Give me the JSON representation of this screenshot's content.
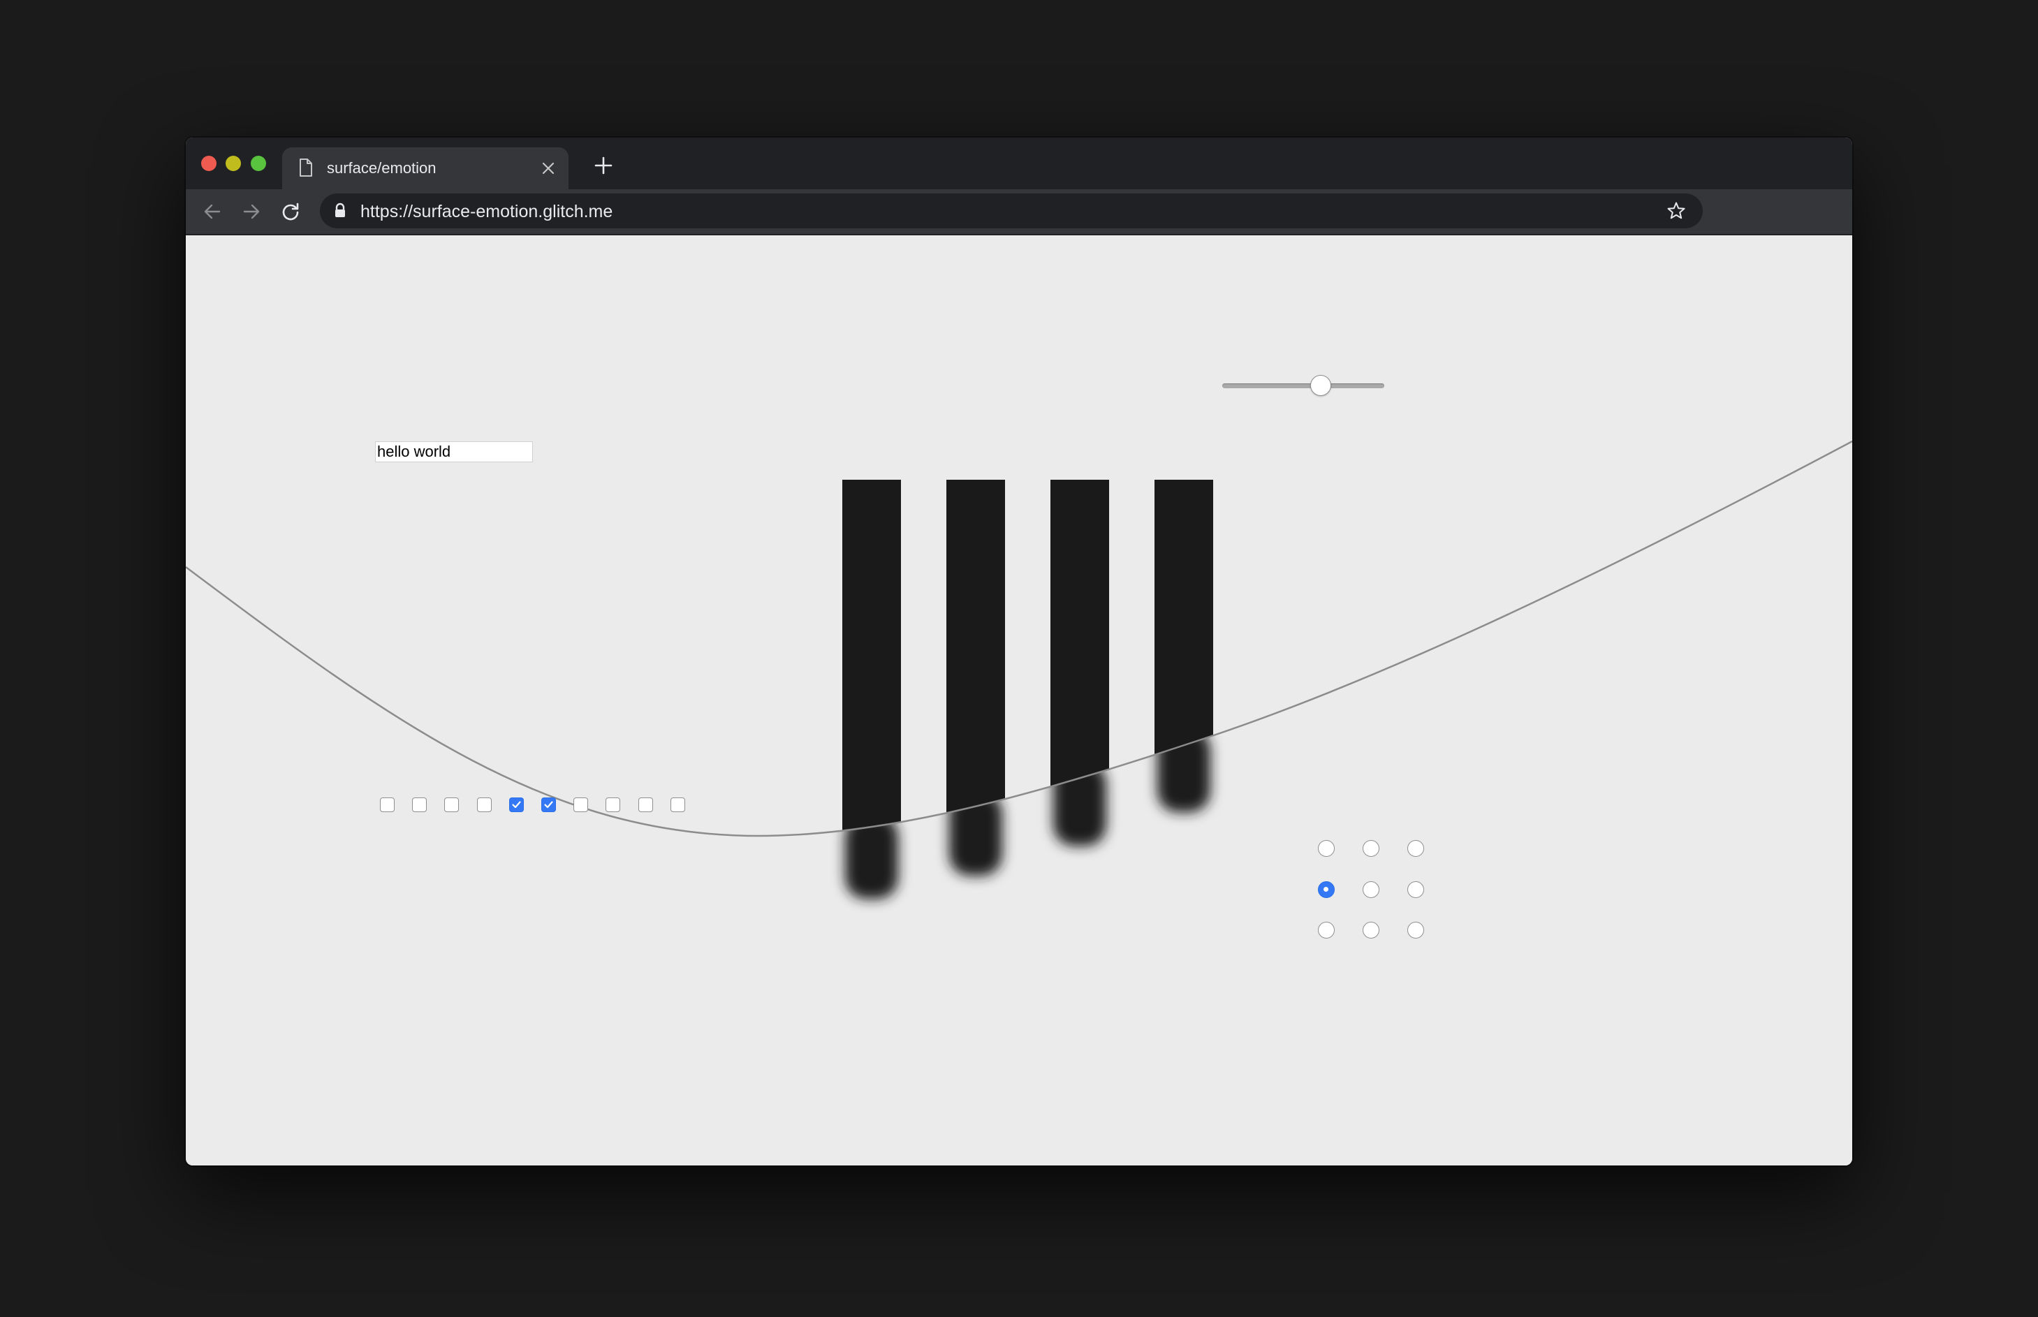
{
  "browser": {
    "tab": {
      "title": "surface/emotion",
      "icon": "document-icon"
    },
    "address": {
      "url": "https://surface-emotion.glitch.me"
    },
    "nav_icons": [
      "back-arrow-icon",
      "forward-arrow-icon",
      "reload-icon",
      "lock-icon",
      "star-icon",
      "close-icon",
      "plus-icon"
    ]
  },
  "page": {
    "text_input": {
      "value": "hello world"
    },
    "slider": {
      "value": 0.62
    },
    "checkboxes": [
      false,
      false,
      false,
      false,
      true,
      true,
      false,
      false,
      false,
      false
    ],
    "radios": {
      "rows": 3,
      "cols": 3,
      "selected": [
        1,
        0
      ]
    },
    "bars": {
      "count": 4,
      "color": "#1a1a1a"
    },
    "curve_color": "#8c8c8c"
  },
  "colors": {
    "window_bg": "#202124",
    "toolbar_bg": "#35363a",
    "page_bg": "#ebebeb",
    "accent": "#3478f6",
    "traffic_red": "#ee5b51",
    "traffic_yellow": "#c1bc1e",
    "traffic_green": "#59c23f"
  }
}
